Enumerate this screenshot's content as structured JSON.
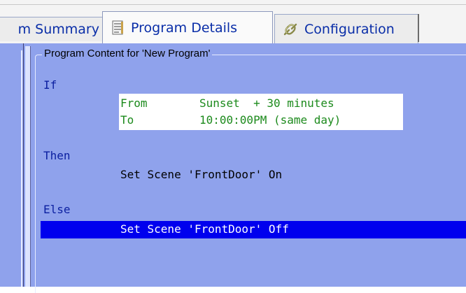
{
  "tabs": [
    {
      "label": "m Summary",
      "icon": "summary-icon"
    },
    {
      "label": "Program Details",
      "icon": "document-icon",
      "active": true
    },
    {
      "label": "Configuration",
      "icon": "link-icon"
    }
  ],
  "content": {
    "group_title": "Program Content for 'New Program'",
    "if_label": "If",
    "from_label": "From",
    "from_value": "Sunset  + 30 minutes",
    "to_label": "To",
    "to_value": "10:00:00PM (same day)",
    "then_label": "Then",
    "then_action": "Set Scene 'FrontDoor' On",
    "else_label": "Else",
    "else_action": "Set Scene 'FrontDoor' Off"
  },
  "colors": {
    "panel_bg": "#8fa2ec",
    "keyword": "#0b1fa0",
    "condition": "#1c8a1c",
    "selection": "#0000ee",
    "tab_text": "#0a2ea8"
  }
}
